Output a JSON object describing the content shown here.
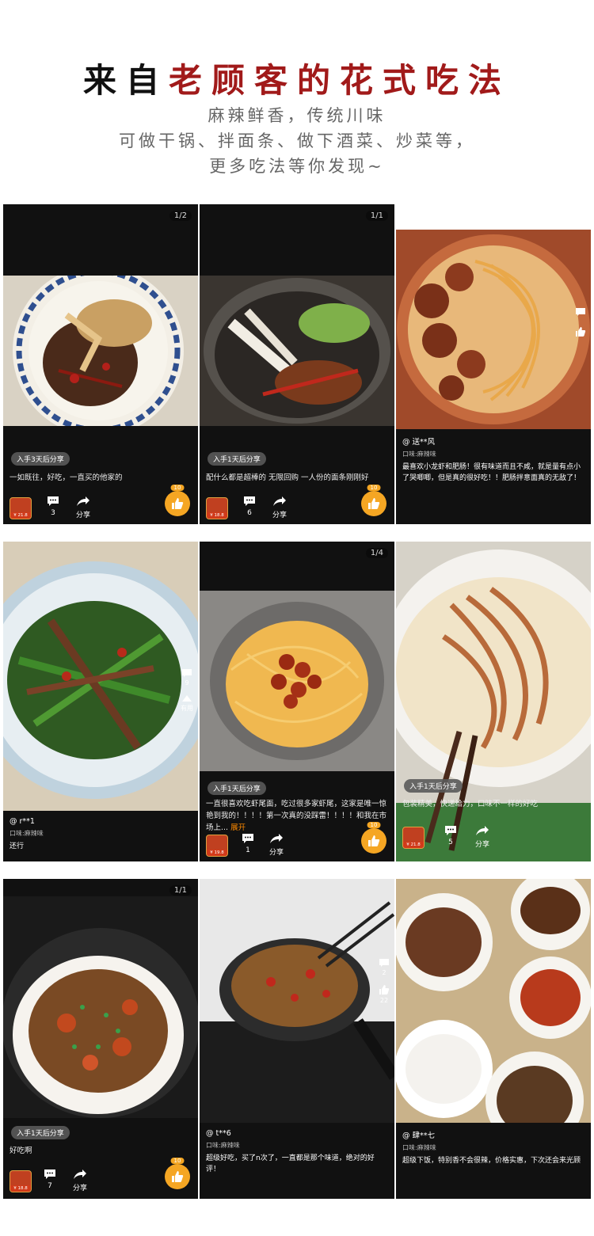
{
  "header": {
    "title_black": "来自",
    "title_red": "老顾客的花式吃法",
    "line1": "麻辣鲜香，传统川味",
    "line2": "可做干锅、拌面条、做下酒菜、炒菜等，",
    "line3": "更多吃法等你发现~"
  },
  "cells": [
    {
      "page": "1/2",
      "badge": "入手3天后分享",
      "caption": "一如既往，好吃，一直买的他家的",
      "price": "¥ 21.8",
      "comments": "3",
      "share": "分享",
      "likes": "10"
    },
    {
      "page": "1/1",
      "badge": "入手1天后分享",
      "caption": "配什么都是超棒的 无限回购 一人份的面条刚刚好",
      "price": "¥ 18.8",
      "comments": "6",
      "share": "分享",
      "likes": "10"
    },
    {
      "user": "@ 送**风",
      "flavor": "口味:麻辣味",
      "text": "最喜欢小龙虾和肥肠！很有味道而且不咸，就是量有点小了哭唧唧，但是真的很好吃！！肥肠拌意面真的无敌了！"
    },
    {
      "side_comments": "9",
      "side_useful": "有用",
      "user": "@ r**1",
      "flavor": "口味:麻辣味",
      "text": "还行"
    },
    {
      "page": "1/4",
      "badge": "入手1天后分享",
      "caption": "一直很喜欢吃虾尾面，吃过很多家虾尾，这家是唯一惊艳到我的！！！！第一次真的没踩雷！！！！和我在市场上...",
      "expand": "展开",
      "price": "¥ 19.8",
      "comments": "1",
      "share": "分享",
      "likes": "10"
    },
    {
      "badge": "入手1天后分享",
      "caption": "包装精美，快递给力，口味不一样的好吃",
      "price": "¥ 21.8",
      "comments": "5",
      "share": "分享"
    },
    {
      "page": "1/1",
      "badge": "入手1天后分享",
      "caption": "好吃啊",
      "price": "¥ 18.8",
      "comments": "7",
      "share": "分享",
      "likes": "10"
    },
    {
      "side_comments": "2",
      "side_likes": "22",
      "user": "@ t**6",
      "flavor": "口味:麻辣味",
      "text": "超级好吃，买了n次了，一直都是那个味道，绝对的好评！"
    },
    {
      "user": "@ 肆**七",
      "flavor": "口味:麻辣味",
      "text": "超级下饭，特别香不会很辣，价格实惠，下次还会来光顾"
    }
  ],
  "colors": {
    "accent_red": "#a11a1a",
    "like_orange": "#f5a623",
    "expand_orange": "#ff8a00"
  },
  "icons": [
    "comment-icon",
    "share-icon",
    "thumbs-up-icon"
  ]
}
